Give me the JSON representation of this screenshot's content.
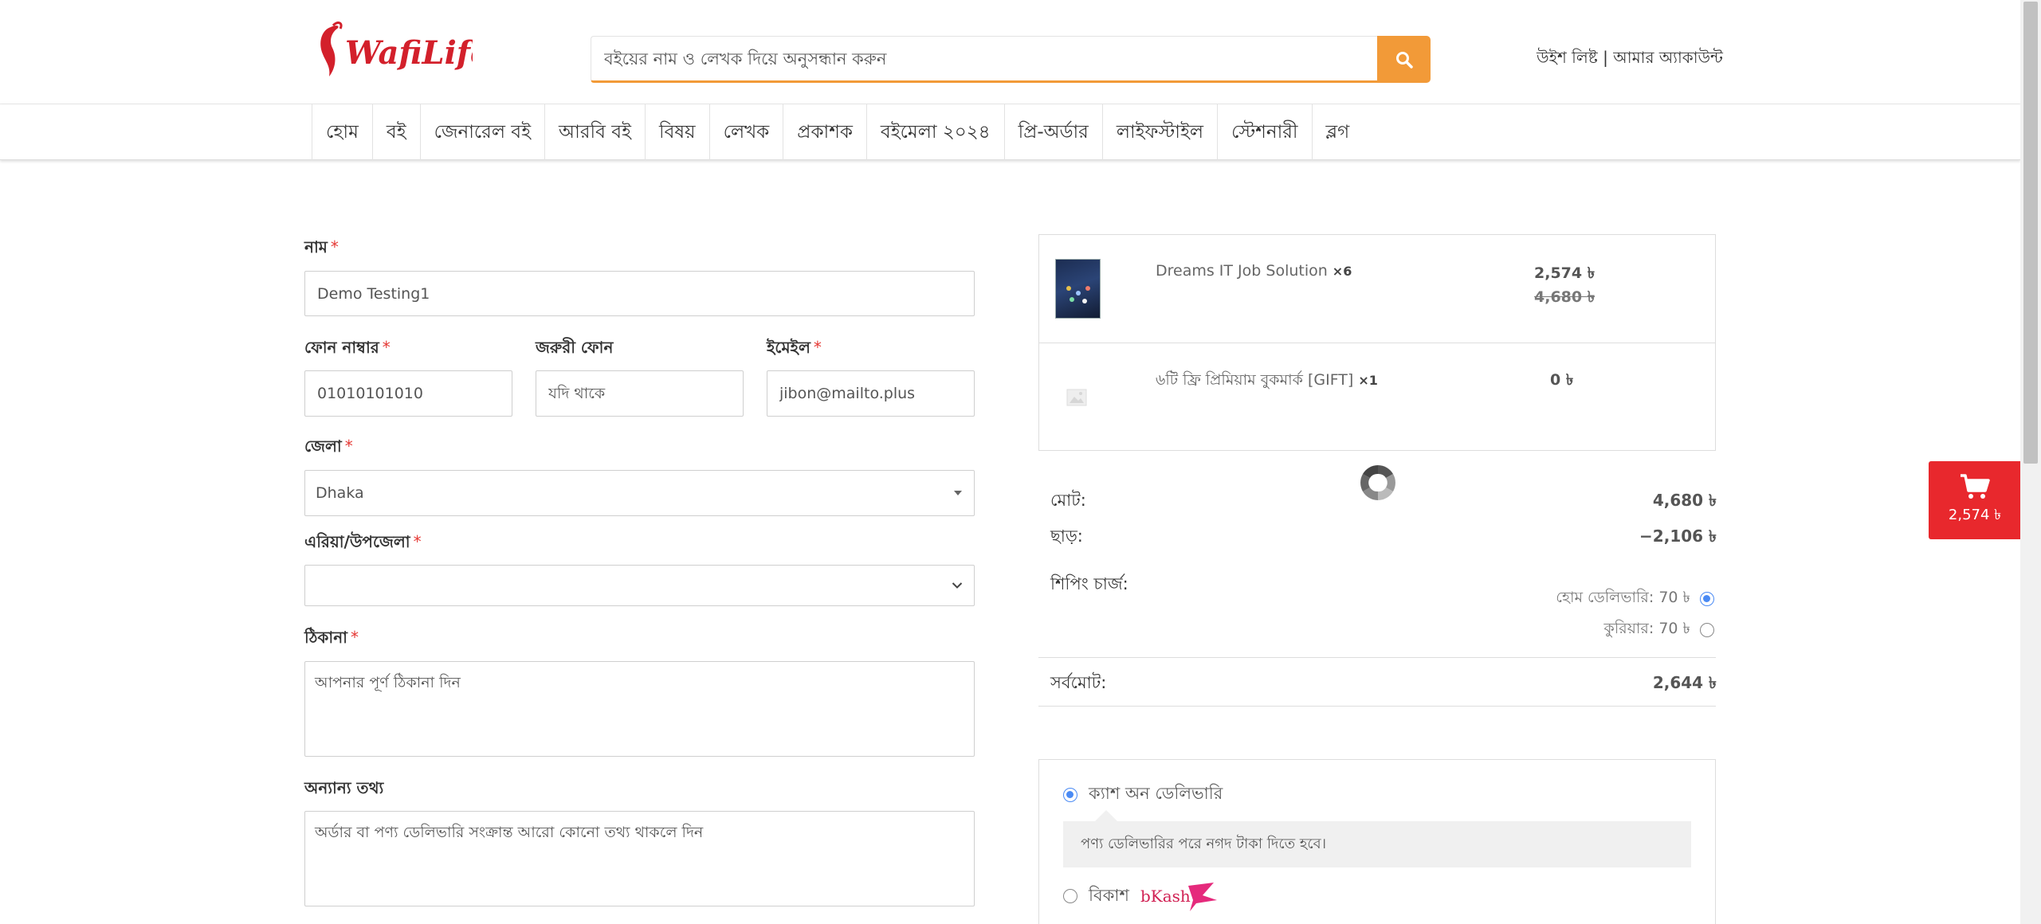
{
  "header": {
    "logo_text": "WafiLife",
    "search_placeholder": "বইয়ের নাম ও লেখক দিয়ে অনুসন্ধান করুন",
    "wishlist": "উইশ লিষ্ট",
    "separator": " | ",
    "account": "আমার অ্যাকাউন্ট"
  },
  "nav": {
    "items": [
      "হোম",
      "বই",
      "জেনারেল বই",
      "আরবি বই",
      "বিষয়",
      "লেখক",
      "প্রকাশক",
      "বইমেলা ২০২৪",
      "প্রি-অর্ডার",
      "লাইফস্টাইল",
      "স্টেশনারী",
      "ব্লগ"
    ]
  },
  "form": {
    "name_label": "নাম",
    "name_value": "Demo Testing1",
    "phone_label": "ফোন নাম্বার",
    "phone_value": "01010101010",
    "emergency_label": "জরুরী ফোন",
    "emergency_placeholder": "যদি থাকে",
    "email_label": "ইমেইল",
    "email_value": "jibon@mailto.plus",
    "district_label": "জেলা",
    "district_value": "Dhaka",
    "area_label": "এরিয়া/উপজেলা",
    "area_value": "",
    "address_label": "ঠিকানা",
    "address_placeholder": "আপনার পূর্ণ ঠিকানা দিন",
    "other_label": "অন্যান্য তথ্য",
    "other_placeholder": "অর্ডার বা পণ্য ডেলিভারি সংক্রান্ত আরো কোনো তথ্য থাকলে দিন",
    "required_mark": "*"
  },
  "order": {
    "items": [
      {
        "name": "Dreams IT Job Solution",
        "qty": "×6",
        "price": "2,574 ৳",
        "old_price": "4,680 ৳"
      },
      {
        "name": "৬টি ফ্রি প্রিমিয়াম বুকমার্ক [GIFT]",
        "qty": "×1",
        "price": "0 ৳"
      }
    ],
    "subtotal_label": "মোট:",
    "subtotal_value": "4,680 ৳",
    "discount_label": "ছাড়:",
    "discount_value": "−2,106 ৳",
    "shipping_label": "শিপিং চার্জ:",
    "shipping_home": "হোম ডেলিভারি: 70 ৳",
    "shipping_courier": "কুরিয়ার: 70 ৳",
    "total_label": "সর্বমোট:",
    "total_value": "2,644 ৳"
  },
  "payment": {
    "cod_label": "ক্যাশ অন ডেলিভারি",
    "cod_note": "পণ্য ডেলিভারির পরে নগদ টাকা দিতে হবে।",
    "bkash_label": "বিকাশ",
    "bkash_logo": "bKash"
  },
  "cart": {
    "amount": "2,574 ৳"
  },
  "colors": {
    "brand_red": "#e8282d",
    "search_orange": "#f29a38",
    "radio_blue": "#4a8af4"
  }
}
